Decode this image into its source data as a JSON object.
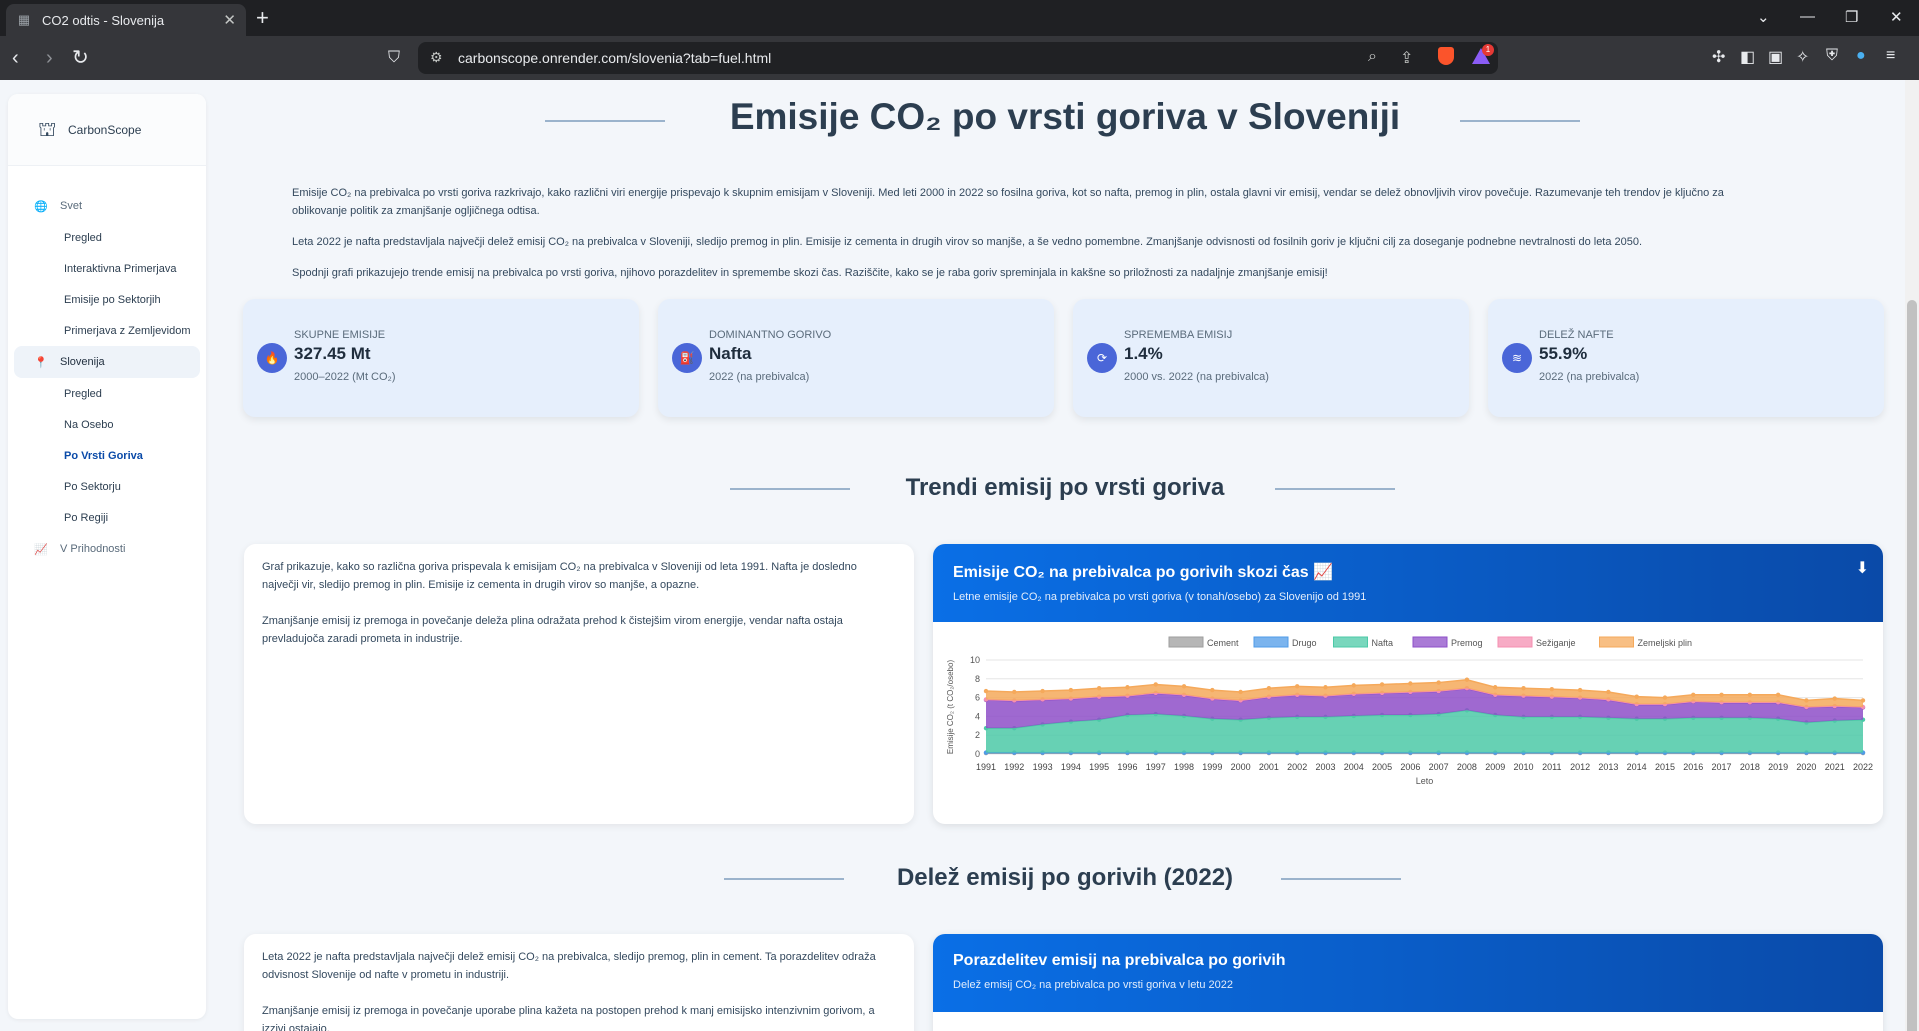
{
  "browser": {
    "tab_title": "CO2 odtis - Slovenija",
    "url": "carbonscope.onrender.com/slovenia?tab=fuel.html",
    "rewards_badge": "1"
  },
  "sidebar": {
    "brand": "CarbonScope",
    "groups": [
      {
        "label": "Svet",
        "items": [
          "Pregled",
          "Interaktivna Primerjava",
          "Emisije po Sektorjih",
          "Primerjava z Zemljevidom"
        ]
      },
      {
        "label": "Slovenija",
        "items": [
          "Pregled",
          "Na Osebo",
          "Po Vrsti Goriva",
          "Po Sektorju",
          "Po Regiji"
        ]
      },
      {
        "label": "V Prihodnosti",
        "items": []
      }
    ]
  },
  "main": {
    "title": "Emisije CO₂ po vrsti goriva v Sloveniji",
    "intro": [
      "Emisije CO₂ na prebivalca po vrsti goriva razkrivajo, kako različni viri energije prispevajo k skupnim emisijam v Sloveniji. Med leti 2000 in 2022 so fosilna goriva, kot so nafta, premog in plin, ostala glavni vir emisij, vendar se delež obnovljivih virov povečuje. Razumevanje teh trendov je ključno za oblikovanje politik za zmanjšanje ogljičnega odtisa.",
      "Leta 2022 je nafta predstavljala največji delež emisij CO₂ na prebivalca v Sloveniji, sledijo premog in plin. Emisije iz cementa in drugih virov so manjše, a še vedno pomembne. Zmanjšanje odvisnosti od fosilnih goriv je ključni cilj za doseganje podnebne nevtralnosti do leta 2050.",
      "Spodnji grafi prikazujejo trende emisij na prebivalca po vrsti goriva, njihovo porazdelitev in spremembe skozi čas. Raziščite, kako se je raba goriv spreminjala in kakšne so priložnosti za nadaljnje zmanjšanje emisij!"
    ],
    "stats": [
      {
        "label": "SKUPNE EMISIJE",
        "value": "327.45 Mt",
        "sub": "2000–2022 (Mt CO₂)",
        "icon": "fire-icon"
      },
      {
        "label": "DOMINANTNO GORIVO",
        "value": "Nafta",
        "sub": "2022 (na prebivalca)",
        "icon": "gas-pump-icon"
      },
      {
        "label": "SPREMEMBA EMISIJ",
        "value": "1.4%",
        "sub": "2000 vs. 2022 (na prebivalca)",
        "icon": "sync-icon"
      },
      {
        "label": "DELEŽ NAFTE",
        "value": "55.9%",
        "sub": "2022 (na prebivalca)",
        "icon": "layers-icon"
      }
    ],
    "trend_section": {
      "title": "Trendi emisij po vrsti goriva",
      "text": [
        "Graf prikazuje, kako so različna goriva prispevala k emisijam CO₂ na prebivalca v Sloveniji od leta 1991. Nafta je dosledno največji vir, sledijo premog in plin. Emisije iz cementa in drugih virov so manjše, a opazne.",
        "Zmanjšanje emisij iz premoga in povečanje deleža plina odražata prehod k čistejšim virom energije, vendar nafta ostaja prevladujoča zaradi prometa in industrije."
      ],
      "chart_title": "Emisije CO₂ na prebivalca po gorivih skozi čas 📈",
      "chart_subtitle": "Letne emisije CO₂ na prebivalca po vrsti goriva (v tonah/osebo) za Slovenijo od 1991"
    },
    "share_section": {
      "title": "Delež emisij po gorivih (2022)",
      "text": [
        "Leta 2022 je nafta predstavljala največji delež emisij CO₂ na prebivalca, sledijo premog, plin in cement. Ta porazdelitev odraža odvisnost Slovenije od nafte v prometu in industriji.",
        "Zmanjšanje emisij iz premoga in povečanje uporabe plina kažeta na postopen prehod k manj emisijsko intenzivnim gorivom, a izzivi ostajajo."
      ],
      "chart_title": "Porazdelitev emisij na prebivalca po gorivih",
      "chart_subtitle": "Delež emisij CO₂ na prebivalca po vrsti goriva v letu 2022"
    }
  },
  "chart_data": {
    "type": "area",
    "stacked": true,
    "xlabel": "Leto",
    "ylabel": "Emisije CO₂ (t CO₂/osebo)",
    "ylim": [
      0,
      10
    ],
    "yticks": [
      0,
      2,
      4,
      6,
      8,
      10
    ],
    "legend_position": "top",
    "x": [
      "1991",
      "1992",
      "1993",
      "1994",
      "1995",
      "1996",
      "1997",
      "1998",
      "1999",
      "2000",
      "2001",
      "2002",
      "2003",
      "2004",
      "2005",
      "2006",
      "2007",
      "2008",
      "2009",
      "2010",
      "2011",
      "2012",
      "2013",
      "2014",
      "2015",
      "2016",
      "2017",
      "2018",
      "2019",
      "2020",
      "2021",
      "2022"
    ],
    "series": [
      {
        "name": "Cement",
        "color": "#9e9e9e",
        "values": [
          0.1,
          0.1,
          0.1,
          0.1,
          0.1,
          0.1,
          0.1,
          0.1,
          0.1,
          0.1,
          0.1,
          0.1,
          0.1,
          0.1,
          0.1,
          0.1,
          0.1,
          0.1,
          0.1,
          0.1,
          0.1,
          0.1,
          0.1,
          0.1,
          0.1,
          0.1,
          0.1,
          0.1,
          0.1,
          0.1,
          0.1,
          0.1
        ]
      },
      {
        "name": "Drugo",
        "color": "#4f9be8",
        "values": [
          0.05,
          0.05,
          0.05,
          0.05,
          0.05,
          0.05,
          0.05,
          0.05,
          0.05,
          0.05,
          0.05,
          0.05,
          0.05,
          0.05,
          0.05,
          0.05,
          0.05,
          0.05,
          0.05,
          0.05,
          0.05,
          0.05,
          0.05,
          0.05,
          0.05,
          0.05,
          0.05,
          0.05,
          0.05,
          0.05,
          0.05,
          0.05
        ]
      },
      {
        "name": "Nafta",
        "color": "#4cc9a7",
        "values": [
          2.6,
          2.6,
          3.0,
          3.3,
          3.5,
          4.0,
          4.1,
          3.9,
          3.6,
          3.5,
          3.7,
          3.8,
          3.8,
          3.9,
          4.0,
          4.0,
          4.1,
          4.5,
          4.0,
          3.8,
          3.8,
          3.8,
          3.7,
          3.6,
          3.6,
          3.7,
          3.7,
          3.7,
          3.6,
          3.2,
          3.4,
          3.5
        ]
      },
      {
        "name": "Premog",
        "color": "#8e4fc8",
        "values": [
          3.0,
          2.9,
          2.6,
          2.4,
          2.4,
          2.0,
          2.2,
          2.2,
          2.1,
          2.0,
          2.2,
          2.3,
          2.2,
          2.3,
          2.3,
          2.4,
          2.4,
          2.3,
          2.1,
          2.2,
          2.1,
          2.0,
          1.9,
          1.5,
          1.5,
          1.7,
          1.6,
          1.6,
          1.7,
          1.6,
          1.5,
          1.3
        ]
      },
      {
        "name": "Sežiganje",
        "color": "#f48fb1",
        "values": [
          0.05,
          0.05,
          0.05,
          0.05,
          0.05,
          0.05,
          0.05,
          0.05,
          0.05,
          0.05,
          0.05,
          0.05,
          0.05,
          0.05,
          0.05,
          0.05,
          0.05,
          0.05,
          0.05,
          0.05,
          0.05,
          0.05,
          0.05,
          0.05,
          0.05,
          0.05,
          0.05,
          0.05,
          0.05,
          0.05,
          0.05,
          0.05
        ]
      },
      {
        "name": "Zemeljski plin",
        "color": "#f5a95b",
        "values": [
          0.9,
          0.9,
          0.9,
          0.9,
          0.9,
          0.9,
          0.9,
          0.9,
          0.9,
          0.9,
          0.9,
          0.9,
          0.9,
          0.9,
          0.9,
          0.9,
          0.9,
          0.9,
          0.8,
          0.8,
          0.8,
          0.8,
          0.8,
          0.8,
          0.7,
          0.7,
          0.8,
          0.8,
          0.8,
          0.7,
          0.8,
          0.7
        ]
      }
    ]
  }
}
